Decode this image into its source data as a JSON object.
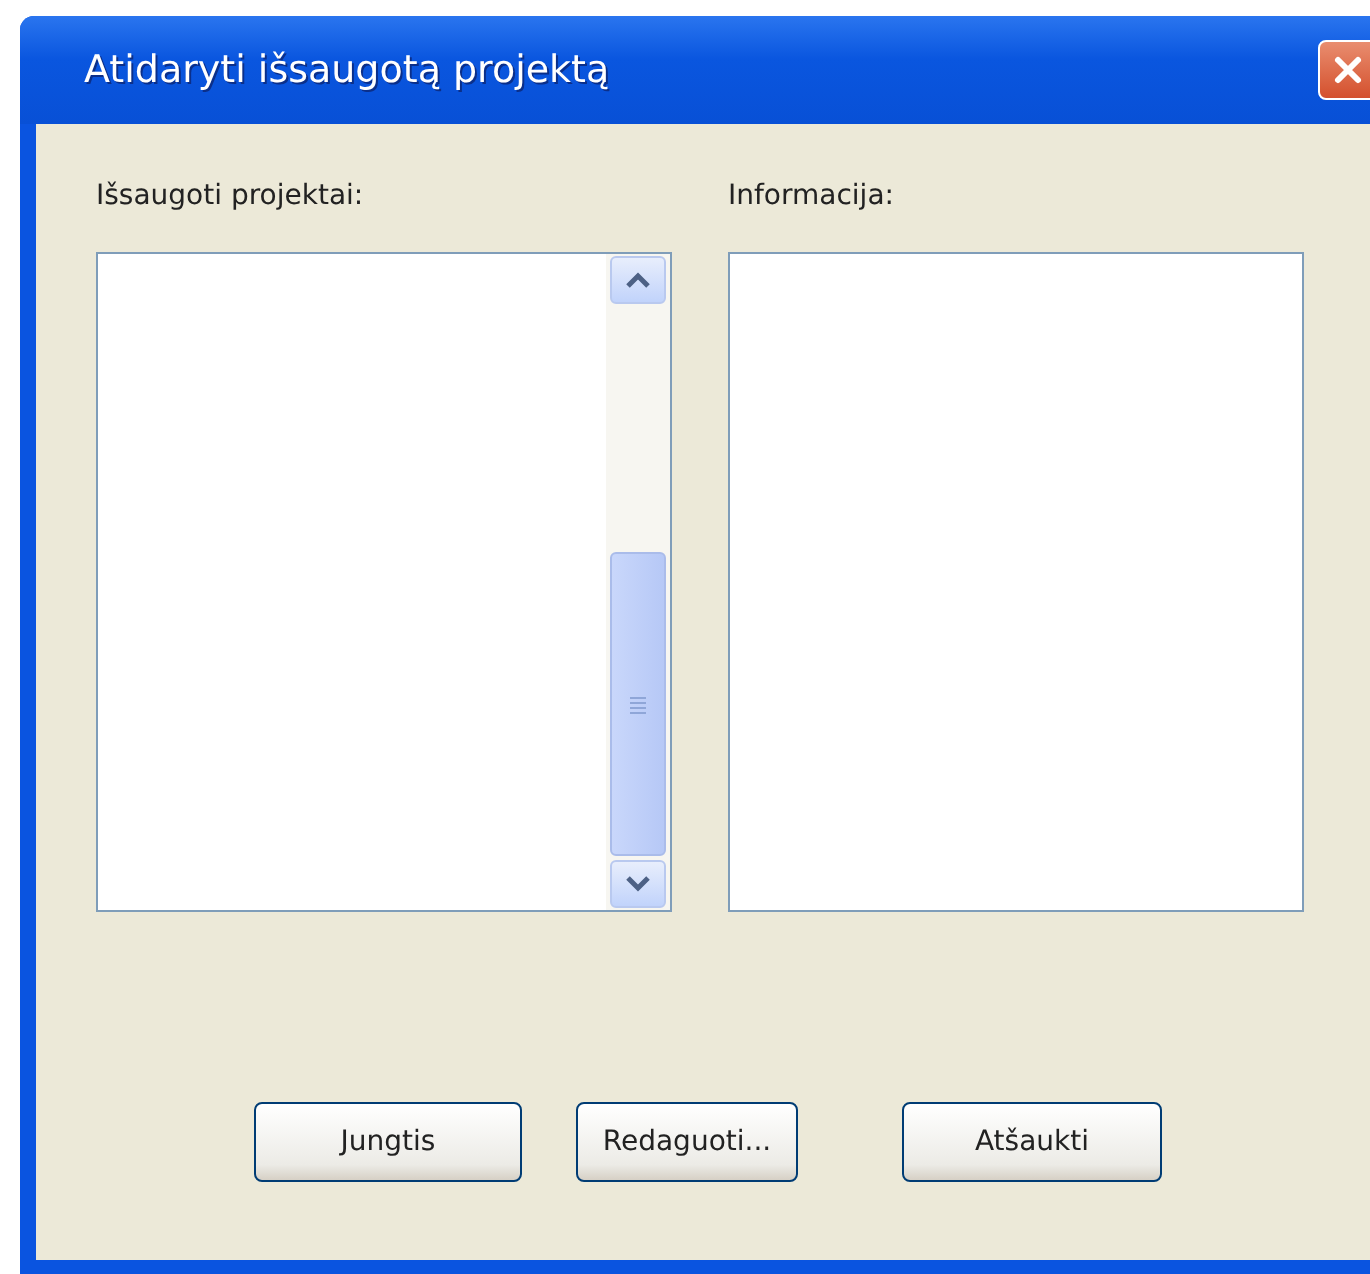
{
  "window": {
    "title": "Atidaryti išsaugotą projektą"
  },
  "saved_projects": {
    "label": "Išsaugoti projektai:"
  },
  "information": {
    "label": "Informacija:"
  },
  "buttons": [
    {
      "label": "Jungtis"
    },
    {
      "label": "Redaguoti..."
    },
    {
      "label": "Atšaukti"
    }
  ]
}
